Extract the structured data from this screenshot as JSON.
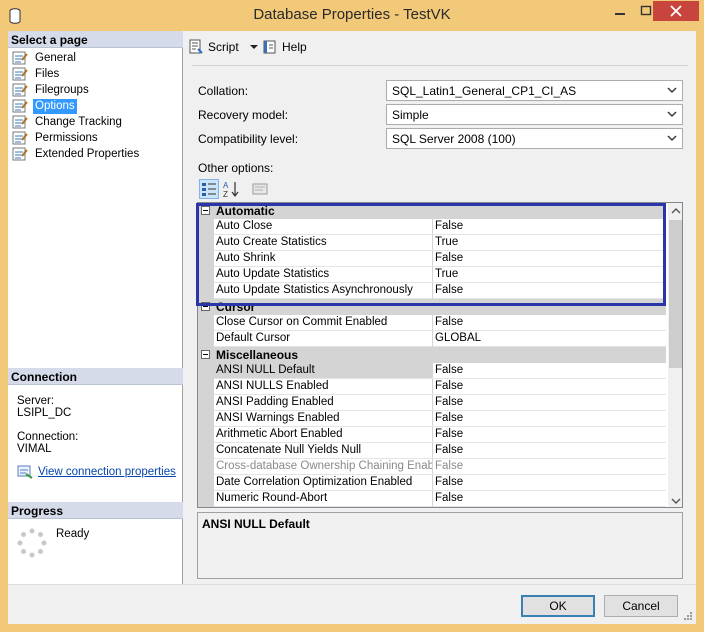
{
  "window": {
    "title": "Database Properties - TestVK"
  },
  "left_panel": {
    "select_page_header": "Select a page",
    "pages": [
      {
        "label": "General",
        "icon": "page-icon"
      },
      {
        "label": "Files",
        "icon": "page-icon"
      },
      {
        "label": "Filegroups",
        "icon": "page-icon"
      },
      {
        "label": "Options",
        "icon": "page-icon",
        "selected": true
      },
      {
        "label": "Change Tracking",
        "icon": "page-icon"
      },
      {
        "label": "Permissions",
        "icon": "page-icon"
      },
      {
        "label": "Extended Properties",
        "icon": "page-icon"
      }
    ],
    "connection_header": "Connection",
    "server_label": "Server:",
    "server_value": "LSIPL_DC",
    "connection_label": "Connection:",
    "connection_value": "VIMAL",
    "view_connection_link": "View connection properties",
    "progress_header": "Progress",
    "progress_status": "Ready"
  },
  "toolbar": {
    "script_label": "Script",
    "help_label": "Help"
  },
  "fields": {
    "collation_label": "Collation:",
    "collation_value": "SQL_Latin1_General_CP1_CI_AS",
    "recovery_label": "Recovery model:",
    "recovery_value": "Simple",
    "compat_label": "Compatibility level:",
    "compat_value": "SQL Server 2008 (100)",
    "other_options_label": "Other options:"
  },
  "grid": {
    "automatic": {
      "title": "Automatic",
      "rows": [
        {
          "name": "Auto Close",
          "value": "False"
        },
        {
          "name": "Auto Create Statistics",
          "value": "True"
        },
        {
          "name": "Auto Shrink",
          "value": "False"
        },
        {
          "name": "Auto Update Statistics",
          "value": "True"
        },
        {
          "name": "Auto Update Statistics Asynchronously",
          "value": "False"
        }
      ]
    },
    "cursor": {
      "title": "Cursor",
      "rows": [
        {
          "name": "Close Cursor on Commit Enabled",
          "value": "False"
        },
        {
          "name": "Default Cursor",
          "value": "GLOBAL"
        }
      ]
    },
    "misc": {
      "title": "Miscellaneous",
      "rows": [
        {
          "name": "ANSI NULL Default",
          "value": "False"
        },
        {
          "name": "ANSI NULLS Enabled",
          "value": "False"
        },
        {
          "name": "ANSI Padding Enabled",
          "value": "False"
        },
        {
          "name": "ANSI Warnings Enabled",
          "value": "False"
        },
        {
          "name": "Arithmetic Abort Enabled",
          "value": "False"
        },
        {
          "name": "Concatenate Null Yields Null",
          "value": "False"
        },
        {
          "name": "Cross-database Ownership Chaining Enabled",
          "value": "False"
        },
        {
          "name": "Date Correlation Optimization Enabled",
          "value": "False"
        },
        {
          "name": "Numeric Round-Abort",
          "value": "False"
        }
      ]
    }
  },
  "description": {
    "title": "ANSI NULL Default"
  },
  "buttons": {
    "ok": "OK",
    "cancel": "Cancel"
  },
  "colors": {
    "highlight_box": "#2a36a8",
    "title_bar": "#f2c879",
    "close_button": "#c7453d",
    "selection": "#3399ff"
  }
}
